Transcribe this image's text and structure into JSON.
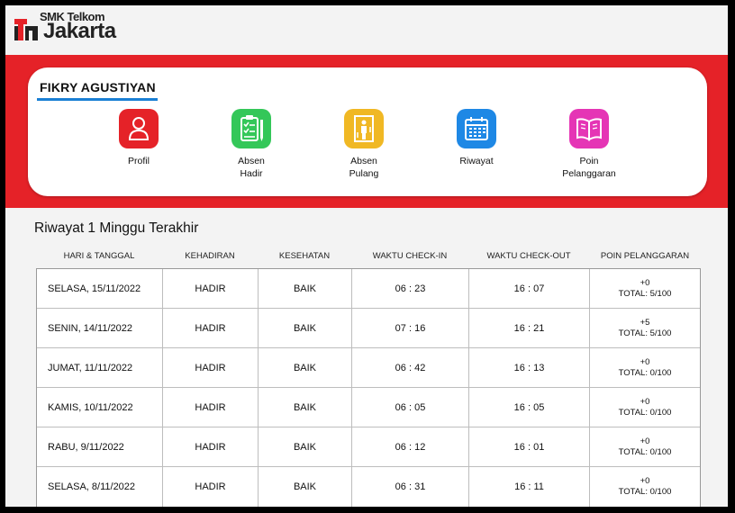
{
  "brand": {
    "top_text": "SMK Telkom",
    "main_text": "Jakarta",
    "accent": "#e52228"
  },
  "user": {
    "name": "FIKRY AGUSTIYAN",
    "underline_color": "#1a7fd4"
  },
  "menu": [
    {
      "label": "Profil",
      "icon": "profile-icon",
      "color": "#e52228"
    },
    {
      "label": "Absen\nHadir",
      "icon": "clipboard-checklist-icon",
      "color": "#34c759"
    },
    {
      "label": "Absen\nPulang",
      "icon": "exit-door-icon",
      "color": "#f0b824"
    },
    {
      "label": "Riwayat",
      "icon": "calendar-icon",
      "color": "#1e88e5"
    },
    {
      "label": "Poin\nPelanggaran",
      "icon": "open-book-icon",
      "color": "#e535b5"
    }
  ],
  "history": {
    "title": "Riwayat 1 Minggu Terakhir",
    "headers": [
      "HARI & TANGGAL",
      "KEHADIRAN",
      "KESEHATAN",
      "WAKTU CHECK-IN",
      "WAKTU CHECK-OUT",
      "POIN PELANGGARAN"
    ],
    "rows": [
      {
        "date": "SELASA, 15/11/2022",
        "attendance": "HADIR",
        "health": "BAIK",
        "checkin": "06 : 23",
        "checkout": "16 : 07",
        "points": "+0",
        "total": "TOTAL: 5/100"
      },
      {
        "date": "SENIN, 14/11/2022",
        "attendance": "HADIR",
        "health": "BAIK",
        "checkin": "07 : 16",
        "checkout": "16 : 21",
        "points": "+5",
        "total": "TOTAL: 5/100"
      },
      {
        "date": "JUMAT, 11/11/2022",
        "attendance": "HADIR",
        "health": "BAIK",
        "checkin": "06 : 42",
        "checkout": "16 : 13",
        "points": "+0",
        "total": "TOTAL: 0/100"
      },
      {
        "date": "KAMIS, 10/11/2022",
        "attendance": "HADIR",
        "health": "BAIK",
        "checkin": "06 : 05",
        "checkout": "16 : 05",
        "points": "+0",
        "total": "TOTAL: 0/100"
      },
      {
        "date": "RABU, 9/11/2022",
        "attendance": "HADIR",
        "health": "BAIK",
        "checkin": "06 : 12",
        "checkout": "16 : 01",
        "points": "+0",
        "total": "TOTAL: 0/100"
      },
      {
        "date": "SELASA, 8/11/2022",
        "attendance": "HADIR",
        "health": "BAIK",
        "checkin": "06 : 31",
        "checkout": "16 : 11",
        "points": "+0",
        "total": "TOTAL: 0/100"
      }
    ]
  }
}
